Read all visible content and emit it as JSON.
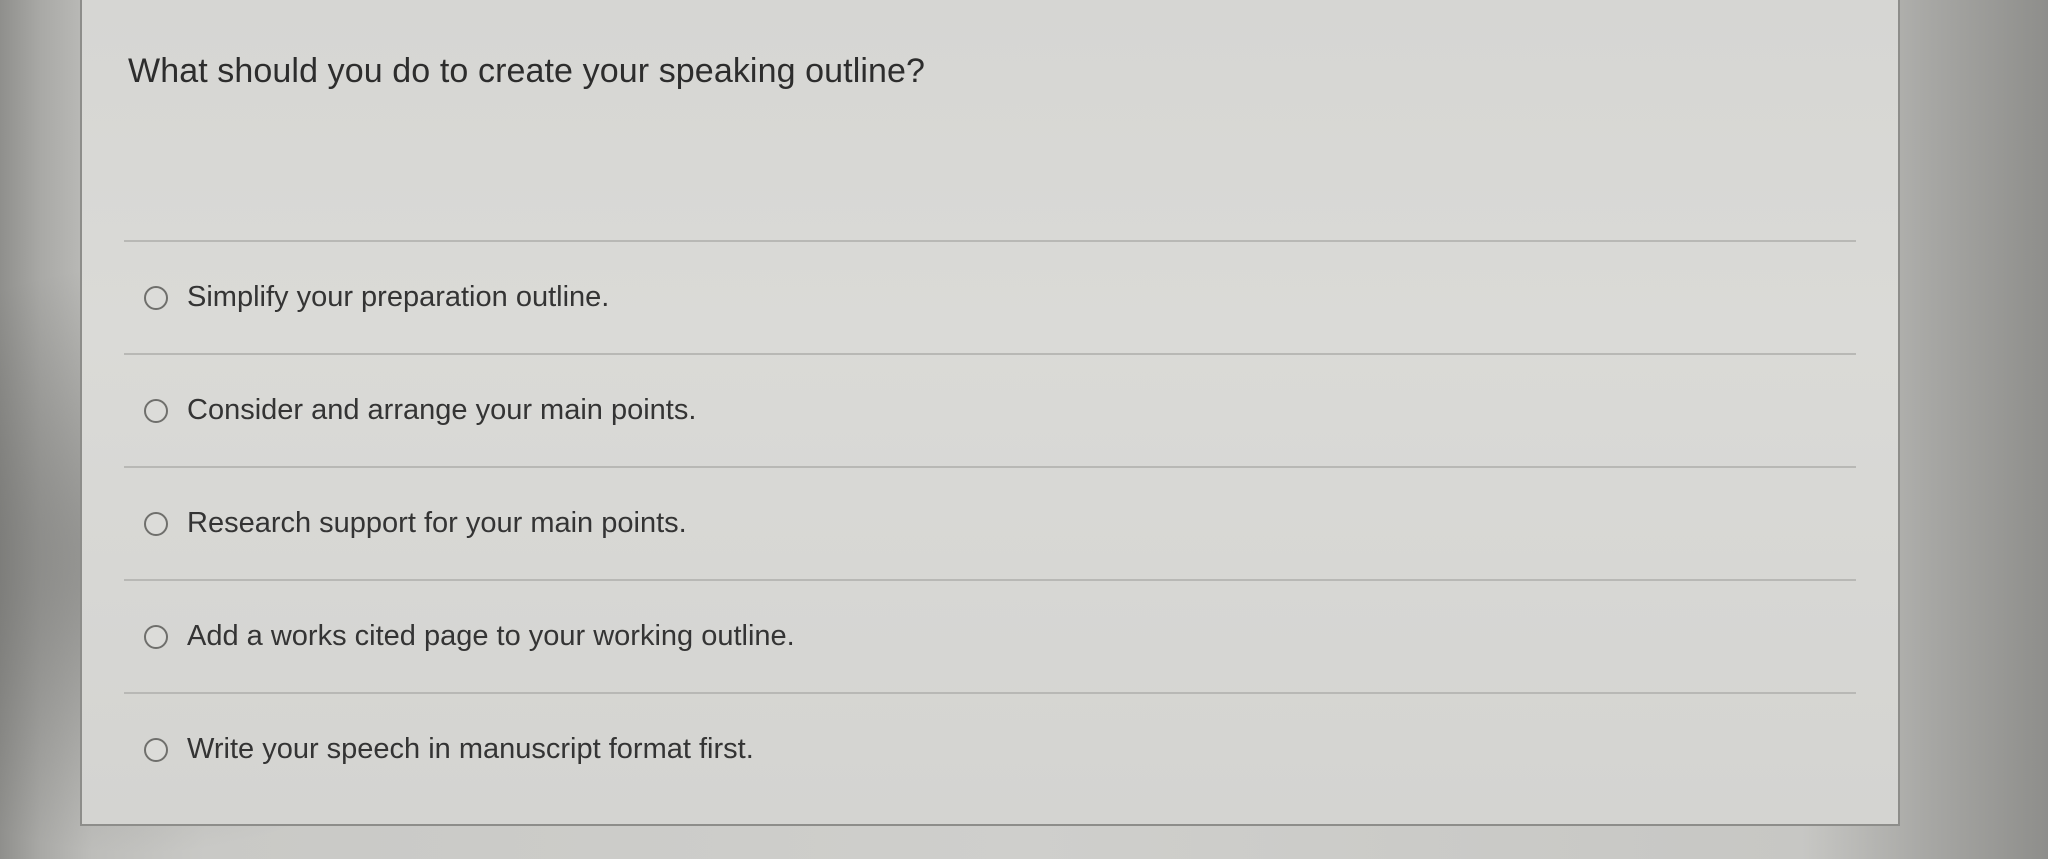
{
  "question": {
    "text": "What should you do to create your speaking outline?"
  },
  "options": [
    {
      "label": "Simplify your preparation outline.",
      "selected": false
    },
    {
      "label": "Consider and arrange your main points.",
      "selected": false
    },
    {
      "label": "Research support for your main points.",
      "selected": false
    },
    {
      "label": "Add a works cited page to your working outline.",
      "selected": false
    },
    {
      "label": "Write your speech in manuscript format first.",
      "selected": false
    }
  ]
}
